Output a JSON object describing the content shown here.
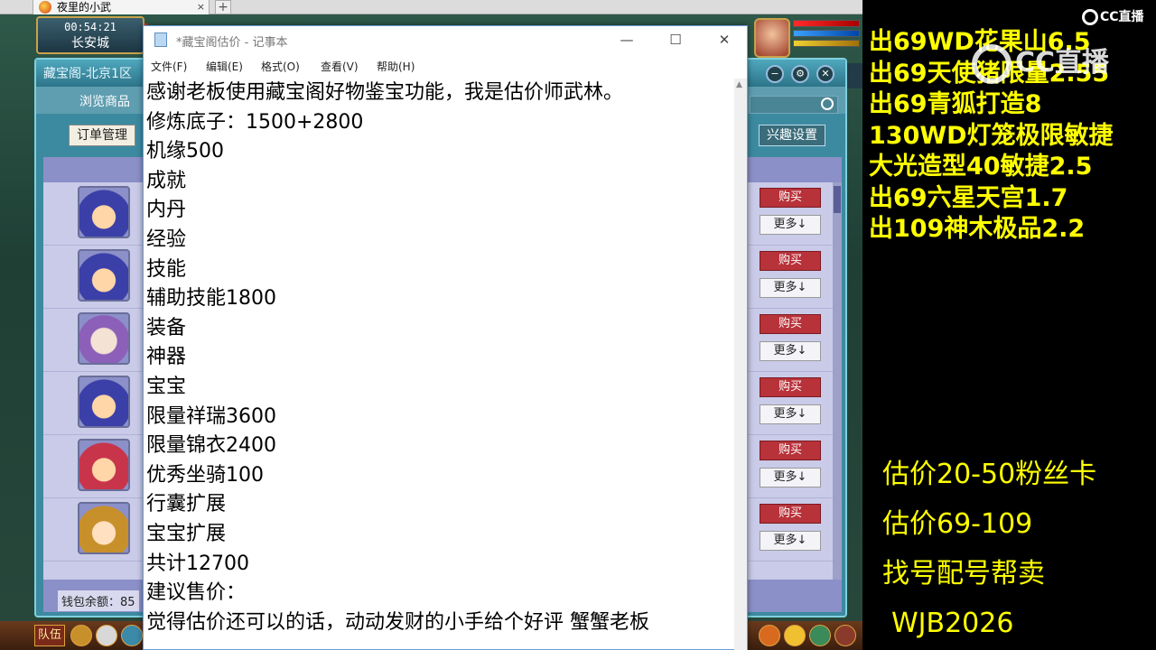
{
  "browser": {
    "tab_title": "夜里的小武",
    "tab_close": "×",
    "new_tab": "+"
  },
  "game": {
    "time": "00:54:21",
    "city": "长安城",
    "panel_title": "藏宝阁-北京1区",
    "tab_browse": "浏览商品",
    "orders_button": "订单管理",
    "interest_button": "兴趣设置",
    "wallet_label": "钱包余额：85",
    "team_button": "队伍",
    "panel_controls": [
      "−",
      "⚙",
      "✕"
    ],
    "rows": [
      {
        "avatar": "av-blue",
        "buy": "购买",
        "more": "更多↓"
      },
      {
        "avatar": "av-blue",
        "buy": "购买",
        "more": "更多↓"
      },
      {
        "avatar": "av-pink",
        "buy": "购买",
        "more": "更多↓"
      },
      {
        "avatar": "av-blue",
        "buy": "购买",
        "more": "更多↓"
      },
      {
        "avatar": "av-red",
        "buy": "购买",
        "more": "更多↓"
      },
      {
        "avatar": "av-gold",
        "buy": "购买",
        "more": "更多↓"
      }
    ]
  },
  "notepad": {
    "title": "*藏宝阁估价 - 记事本",
    "menu": [
      "文件(F)",
      "编辑(E)",
      "格式(O)",
      "查看(V)",
      "帮助(H)"
    ],
    "window_buttons": [
      "—",
      "☐",
      "✕"
    ],
    "lines": [
      "感谢老板使用藏宝阁好物鉴宝功能，我是估价师武林。",
      "修炼底子：1500+2800",
      "机缘500",
      "成就",
      "内丹",
      "经验",
      "技能",
      "辅助技能1800",
      "装备",
      "神器",
      "宝宝",
      "限量祥瑞3600",
      "限量锦衣2400",
      "优秀坐骑100",
      "行囊扩展",
      "宝宝扩展",
      "共计12700",
      "建议售价：",
      "觉得估价还可以的话，动动发财的小手给个好评 蟹蟹老板"
    ]
  },
  "overlay": {
    "sale_items": [
      "出69WD花果山6.5",
      "出69天使猪限量2.55",
      "出69青狐打造8",
      "130WD灯笼极限敏捷",
      "大光造型40敏捷2.5",
      "出69六星天宫1.7",
      "出109神木极品2.2"
    ],
    "services": [
      "估价20-50粉丝卡",
      "估价69-109",
      "找号配号帮卖",
      "WJB2026"
    ],
    "logo_small": "CC直播",
    "logo_big": "CC直播"
  },
  "colors": {
    "overlay_text": "#ffff00",
    "overlay_bg": "#000000",
    "buy_button": "#b8323a"
  }
}
